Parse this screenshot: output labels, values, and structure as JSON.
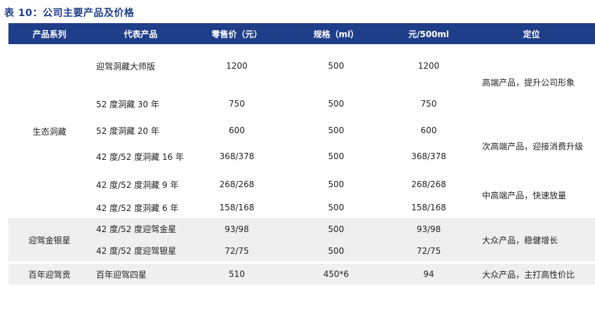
{
  "caption": "表 10：公司主要产品及价格",
  "headers": [
    "产品系列",
    "代表产品",
    "零售价（元）",
    "规格（ml）",
    "元/500ml",
    "定位"
  ],
  "groups": [
    {
      "series": "生态洞藏",
      "rows": [
        {
          "product": "迎驾洞藏大师版",
          "price": "1200",
          "spec": "500",
          "per500": "1200"
        },
        {
          "product": "52 度洞藏 30 年",
          "price": "750",
          "spec": "500",
          "per500": "750"
        },
        {
          "product": "52 度洞藏 20 年",
          "price": "600",
          "spec": "500",
          "per500": "600"
        },
        {
          "product": "42 度/52 度洞藏 16 年",
          "price": "368/378",
          "spec": "500",
          "per500": "368/378"
        },
        {
          "product": "42 度/52 度洞藏 9 年",
          "price": "268/268",
          "spec": "500",
          "per500": "268/268"
        },
        {
          "product": "42 度/52 度洞藏 6 年",
          "price": "158/168",
          "spec": "500",
          "per500": "158/168"
        }
      ],
      "positioning": [
        "高端产品，提升公司形象",
        "次高端产品，迎接消费升级",
        "中高端产品，快速放量"
      ]
    },
    {
      "series": "迎驾金银星",
      "rows": [
        {
          "product": "42 度/52 度迎驾金星",
          "price": "93/98",
          "spec": "500",
          "per500": "93/98"
        },
        {
          "product": "42 度/52 度迎驾银星",
          "price": "72/75",
          "spec": "500",
          "per500": "72/75"
        }
      ],
      "positioning": [
        "大众产品，稳健增长"
      ]
    },
    {
      "series": "百年迎驾贡",
      "rows": [
        {
          "product": "百年迎驾四星",
          "price": "510",
          "spec": "450*6",
          "per500": "94"
        }
      ],
      "positioning": [
        "大众产品，主打高性价比"
      ]
    }
  ]
}
